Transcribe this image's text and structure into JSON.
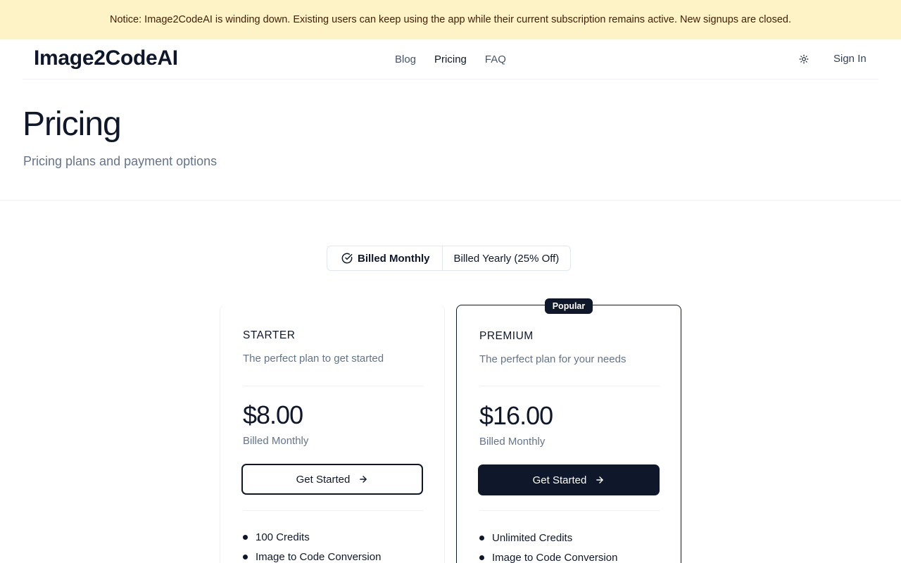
{
  "notice": {
    "text": "Notice: Image2CodeAI is winding down. Existing users can keep using the app while their current subscription remains active. New signups are closed."
  },
  "header": {
    "brand": "Image2CodeAI",
    "nav": [
      {
        "label": "Blog"
      },
      {
        "label": "Pricing"
      },
      {
        "label": "FAQ"
      }
    ],
    "theme_icon": "sun-icon",
    "sign_in_label": "Sign In"
  },
  "page": {
    "title": "Pricing",
    "subtitle": "Pricing plans and payment options"
  },
  "billing": {
    "selected_icon": "check-circle-icon",
    "options": [
      {
        "label": "Billed Monthly",
        "selected": true
      },
      {
        "label": "Billed Yearly (25% Off)",
        "selected": false
      }
    ]
  },
  "plans": [
    {
      "name": "STARTER",
      "description": "The perfect plan to get started",
      "price": "$8.00",
      "billing_note": "Billed Monthly",
      "cta_label": "Get Started",
      "cta_icon": "arrow-right-icon",
      "popular": false,
      "features": [
        "100 Credits",
        "Image to Code Conversion"
      ]
    },
    {
      "name": "PREMIUM",
      "badge": "Popular",
      "description": "The perfect plan for your needs",
      "price": "$16.00",
      "billing_note": "Billed Monthly",
      "cta_label": "Get Started",
      "cta_icon": "arrow-right-icon",
      "popular": true,
      "features": [
        "Unlimited Credits",
        "Image to Code Conversion"
      ]
    }
  ],
  "colors": {
    "notice_bg": "#fef3c7",
    "primary": "#0f172a",
    "muted_text": "#64748b",
    "border": "#e2e8f0"
  }
}
